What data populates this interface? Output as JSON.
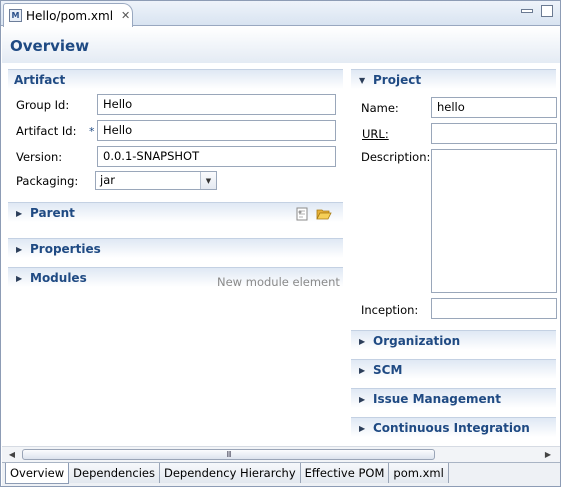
{
  "editor_tab": {
    "title": "Hello/pom.xml",
    "close": "✕",
    "icon_letter": "M"
  },
  "header": {
    "title": "Overview"
  },
  "artifact": {
    "title": "Artifact",
    "group_id_label": "Group Id:",
    "group_id_value": "Hello",
    "artifact_id_label": "Artifact Id:",
    "artifact_id_value": "Hello",
    "required_marker": "*",
    "version_label": "Version:",
    "version_value": "0.0.1-SNAPSHOT",
    "packaging_label": "Packaging:",
    "packaging_value": "jar"
  },
  "parent": {
    "title": "Parent"
  },
  "properties": {
    "title": "Properties"
  },
  "modules": {
    "title": "Modules",
    "new_module_hint": "New module element"
  },
  "project": {
    "title": "Project",
    "name_label": "Name:",
    "name_value": "hello",
    "url_label": "URL:",
    "url_value": "",
    "description_label": "Description:",
    "description_value": "",
    "inception_label": "Inception:",
    "inception_value": ""
  },
  "collapsed_sections": [
    "Organization",
    "SCM",
    "Issue Management",
    "Continuous Integration"
  ],
  "scrollbar": {
    "grip": "III"
  },
  "bottom_tabs": [
    "Overview",
    "Dependencies",
    "Dependency Hierarchy",
    "Effective POM",
    "pom.xml"
  ],
  "icons": {
    "twisty_collapsed": "triangle-right-icon",
    "twisty_expanded": "triangle-down-icon",
    "parent_select": "select-parent-icon",
    "parent_open": "open-folder-icon"
  },
  "colors": {
    "section_title": "#1f4a83",
    "header_gradient_end": "#e4ebf4",
    "border": "#8d9cb5"
  }
}
